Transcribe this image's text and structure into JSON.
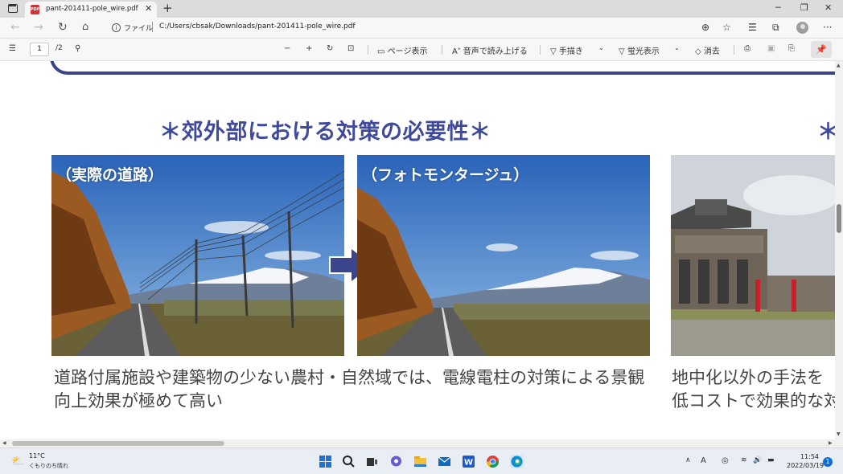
{
  "browser": {
    "tab_title": "pant-201411-pole_wire.pdf",
    "tab_icon": "PDF",
    "address_label": "ファイル",
    "url": "C:/Users/cbsak/Downloads/pant-201411-pole_wire.pdf"
  },
  "pdf_toolbar": {
    "page_current": "1",
    "page_total": "/2",
    "page_view_label": "ページ表示",
    "read_aloud_label": "音声で読み上げる",
    "draw_label": "手描き",
    "highlight_label": "蛍光表示",
    "erase_label": "消去"
  },
  "document": {
    "heading": "＊郊外部における対策の必要性＊",
    "heading_partial": "＊",
    "photo_left_label": "（実際の道路）",
    "photo_right_label": "（フォトモンタージュ）",
    "desc_left_line1": "道路付属施設や建築物の少ない農村・自然域では、電線電柱の対策による景観",
    "desc_left_line2": "向上効果が極めて高い",
    "desc_right_line1": "地中化以外の手法を",
    "desc_right_line2": "低コストで効果的な対"
  },
  "taskbar": {
    "temperature": "11°C",
    "weather_text": "くもりのち晴れ",
    "ime_label": "A",
    "time": "11:54",
    "date": "2022/03/19",
    "notification_count": "1"
  },
  "colors": {
    "heading": "#3f4a9a",
    "arrow": "#3c448e",
    "pdf_icon": "#d13438"
  }
}
